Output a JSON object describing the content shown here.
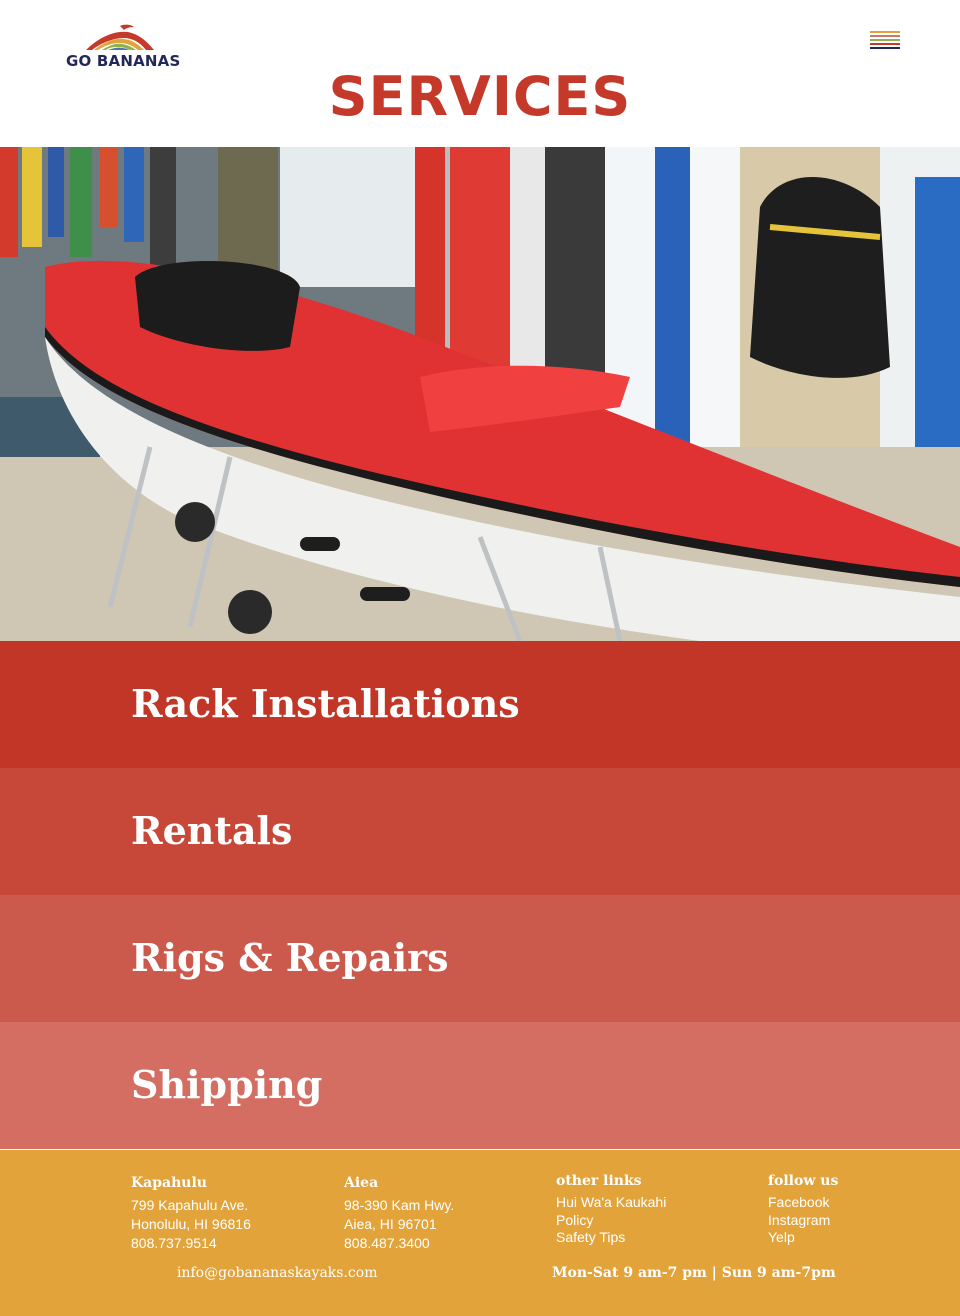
{
  "header": {
    "logo_text": "GO BANANAS",
    "page_title": "SERVICES",
    "menu_icon": "hamburger-menu-icon",
    "menu_stripe_colors": [
      "#e2a43a",
      "#d4736a",
      "#8db34a",
      "#c5392a",
      "#23285a"
    ]
  },
  "hero": {
    "icon": "kayak-shop-photo"
  },
  "services": [
    {
      "label": "Rack Installations",
      "color": "#c13626"
    },
    {
      "label": "Rentals",
      "color": "#c74839"
    },
    {
      "label": "Rigs & Repairs",
      "color": "#cc5a4c"
    },
    {
      "label": "Shipping",
      "color": "#d46e62"
    }
  ],
  "footer": {
    "color": "#e2a43a",
    "kapahulu": {
      "title": "Kapahulu",
      "address1": "799 Kapahulu Ave.",
      "address2": "Honolulu, HI 96816",
      "phone": "808.737.9514"
    },
    "aiea": {
      "title": "Aiea",
      "address1": "98-390 Kam Hwy.",
      "address2": "Aiea, HI 96701",
      "phone": "808.487.3400"
    },
    "other_links": {
      "title": "other links",
      "items": [
        "Hui Wa'a Kaukahi",
        "Policy",
        "Safety Tips"
      ]
    },
    "follow_us": {
      "title": "follow us",
      "items": [
        "Facebook",
        "Instagram",
        "Yelp"
      ]
    },
    "email": "info@gobananaskayaks.com",
    "hours": "Mon-Sat 9 am-7 pm | Sun 9 am-7pm"
  }
}
